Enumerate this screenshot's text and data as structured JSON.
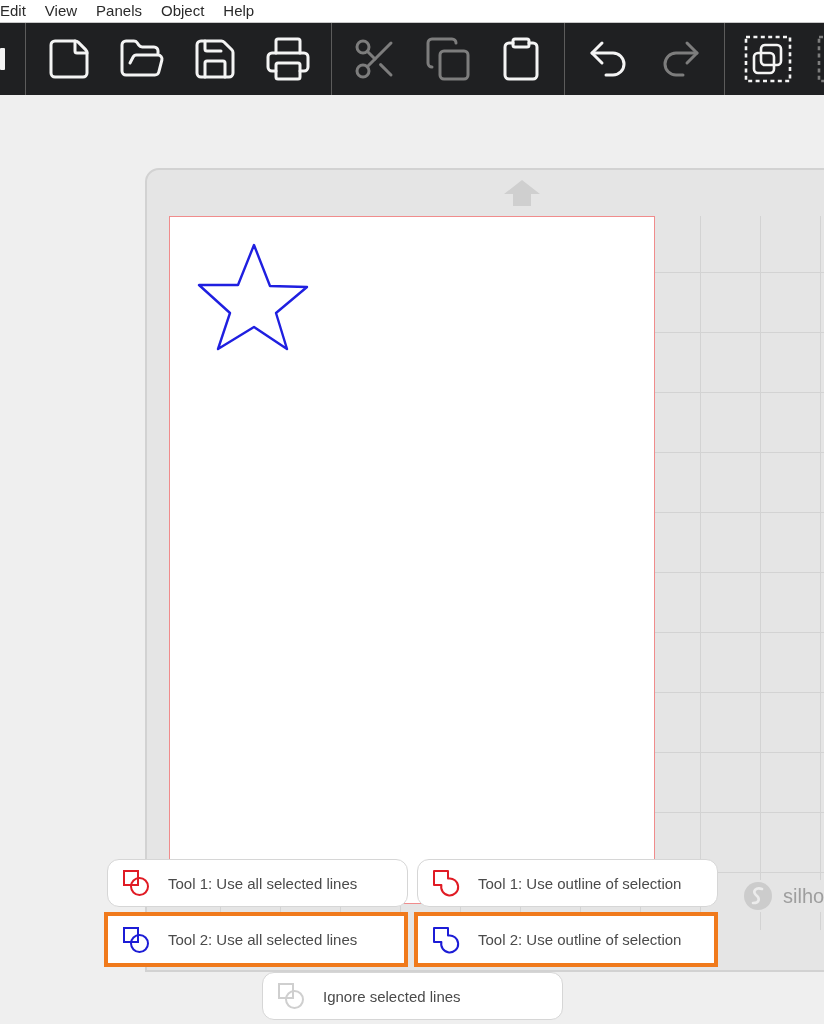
{
  "menu_bar": {
    "items": [
      "Edit",
      "View",
      "Panels",
      "Object",
      "Help"
    ]
  },
  "toolbar": {
    "groups": [
      {
        "items": [
          {
            "kind": "clipped",
            "disabled": false
          }
        ]
      },
      {
        "items": [
          {
            "kind": "new",
            "disabled": false
          },
          {
            "kind": "open",
            "disabled": false
          },
          {
            "kind": "save",
            "disabled": false
          },
          {
            "kind": "print",
            "disabled": false
          }
        ]
      },
      {
        "items": [
          {
            "kind": "cut",
            "disabled": true
          },
          {
            "kind": "copy",
            "disabled": true
          },
          {
            "kind": "paste",
            "disabled": false
          }
        ]
      },
      {
        "items": [
          {
            "kind": "undo",
            "disabled": false
          },
          {
            "kind": "redo",
            "disabled": true
          }
        ]
      },
      {
        "items": [
          {
            "kind": "group",
            "disabled": false
          },
          {
            "kind": "ungroup",
            "disabled": true
          }
        ]
      }
    ]
  },
  "mat": {
    "paper": {
      "shapes": [
        {
          "kind": "star"
        }
      ]
    },
    "logo_text": "silho"
  },
  "cut_options": [
    {
      "kind": "all_lines",
      "label": "Tool 1: Use all selected lines",
      "color": "#e01b24",
      "highlighted": false
    },
    {
      "kind": "outline",
      "label": "Tool 1: Use outline of selection",
      "color": "#e01b24",
      "highlighted": false
    },
    {
      "kind": "all_lines",
      "label": "Tool 2: Use all selected lines",
      "color": "#1c1cd6",
      "highlighted": true
    },
    {
      "kind": "outline",
      "label": "Tool 2: Use outline of selection",
      "color": "#1c1cd6",
      "highlighted": true
    },
    {
      "kind": "ignore",
      "label": "Ignore selected lines",
      "color": "#cfcfcf",
      "highlighted": false
    }
  ]
}
